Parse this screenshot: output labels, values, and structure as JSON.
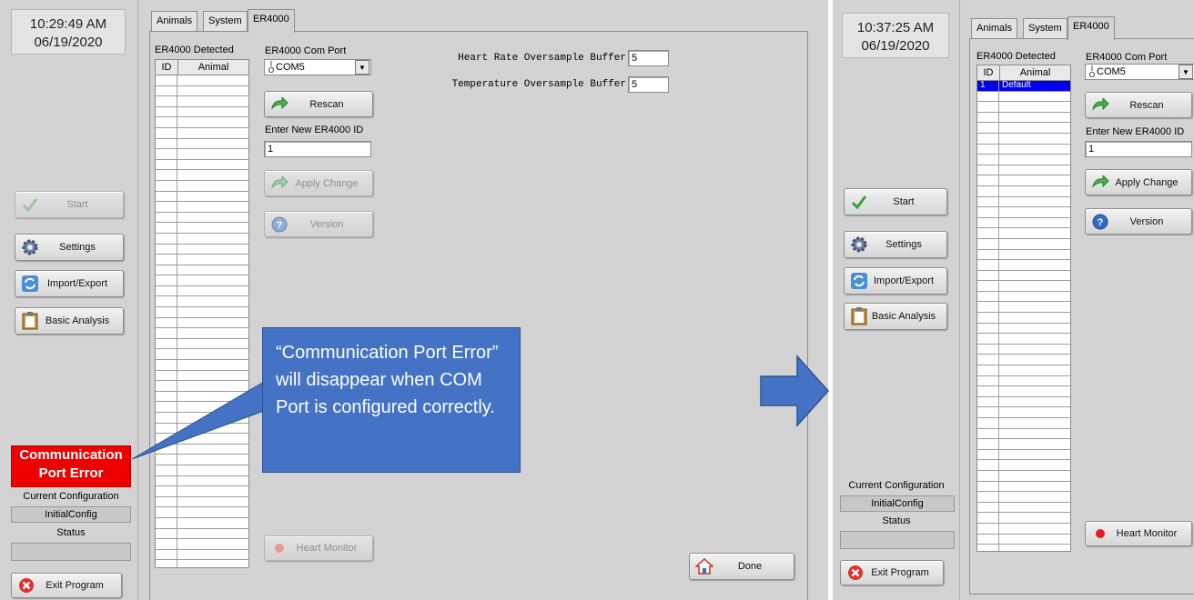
{
  "left": {
    "clock_time": "10:29:49 AM",
    "clock_date": "06/19/2020",
    "buttons": {
      "start": "Start",
      "settings": "Settings",
      "import_export": "Import/Export",
      "basic_analysis": "Basic Analysis",
      "exit": "Exit Program",
      "rescan": "Rescan",
      "apply_change": "Apply Change",
      "version": "Version",
      "heart_monitor": "Heart Monitor",
      "done": "Done"
    },
    "error_line1": "Communication",
    "error_line2": "Port Error",
    "current_config_label": "Current Configuration",
    "current_config_value": "InitialConfig",
    "status_label": "Status",
    "status_value": "",
    "tabs": [
      "Animals",
      "System",
      "ER4000"
    ],
    "detected_label": "ER4000 Detected",
    "col_id": "ID",
    "col_animal": "Animal",
    "com_port_label": "ER4000 Com Port",
    "com_port_value": "COM5",
    "new_id_label": "Enter New ER4000 ID",
    "new_id_value": "1",
    "hr_label": "Heart Rate Oversample Buffer",
    "hr_value": "5",
    "temp_label": "Temperature Oversample Buffer",
    "temp_value": "5"
  },
  "callout_text": "“Communication Port Error” will disappear when COM Port  is configured correctly.",
  "right": {
    "clock_time": "10:37:25 AM",
    "clock_date": "06/19/2020",
    "buttons": {
      "start": "Start",
      "settings": "Settings",
      "import_export": "Import/Export",
      "basic_analysis": "Basic Analysis",
      "exit": "Exit Program",
      "rescan": "Rescan",
      "apply_change": "Apply Change",
      "version": "Version",
      "heart_monitor": "Heart Monitor"
    },
    "current_config_label": "Current Configuration",
    "current_config_value": "InitialConfig",
    "status_label": "Status",
    "status_value": "",
    "tabs": [
      "Animals",
      "System",
      "ER4000"
    ],
    "detected_label": "ER4000 Detected",
    "col_id": "ID",
    "col_animal": "Animal",
    "rows": [
      {
        "id": "1",
        "animal": "Default"
      }
    ],
    "com_port_label": "ER4000 Com Port",
    "com_port_value": "COM5",
    "new_id_label": "Enter New ER4000 ID",
    "new_id_value": "1"
  },
  "colors": {
    "panel": "#d3d3d3",
    "error_red": "#ee0000",
    "callout_blue": "#4472c4",
    "selection_blue": "#0000ee"
  }
}
